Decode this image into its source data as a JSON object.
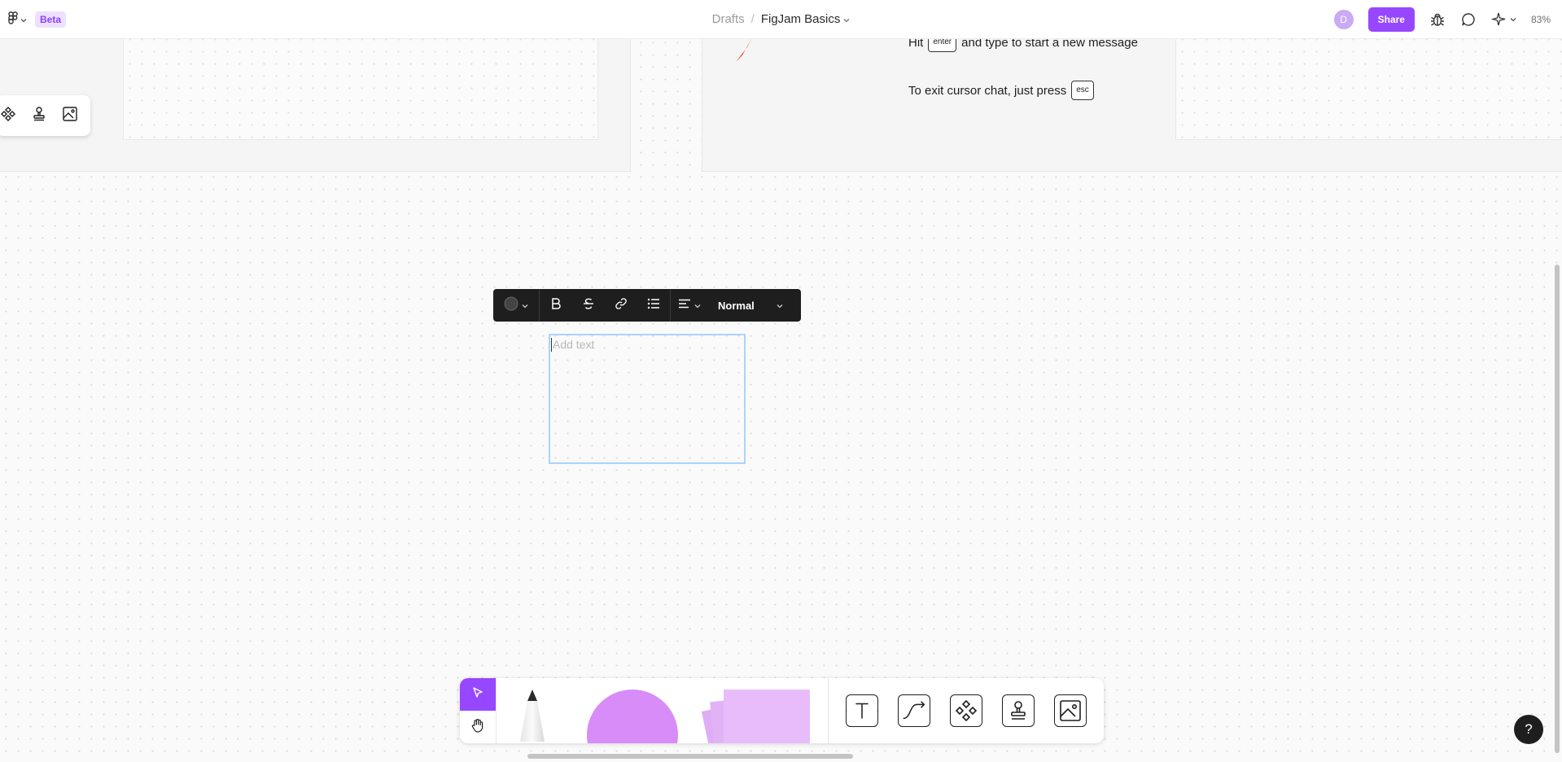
{
  "topbar": {
    "beta_label": "Beta",
    "breadcrumb_parent": "Drafts",
    "breadcrumb_sep": "/",
    "file_name": "FigJam Basics",
    "avatar_initial": "D",
    "share_label": "Share",
    "zoom_label": "83%"
  },
  "canvas": {
    "instruction_hit_prefix": "Hit",
    "enter_key": "enter",
    "instruction_hit_suffix": "and type to start a new message",
    "instruction_exit_prefix": "To exit cursor chat, just press",
    "esc_key": "esc"
  },
  "format_toolbar": {
    "text_style": "Normal"
  },
  "textbox": {
    "placeholder": "Add text"
  },
  "help": {
    "label": "?"
  },
  "colors": {
    "accent": "#9747ff",
    "beta_bg": "#ede1ff",
    "shape_purple": "#d88cf7",
    "sticky_purple": "#e8bcfb",
    "selection_blue": "#a8d4ff",
    "marker_red": "#f24822"
  },
  "icons": {
    "topbar": [
      "figjam-logo-icon",
      "bug-icon",
      "comment-icon",
      "ai-sparkle-icon"
    ],
    "mini_toolbar": [
      "component-icon",
      "stamp-icon",
      "image-icon"
    ],
    "format_toolbar": [
      "color-dot-icon",
      "bold-icon",
      "strikethrough-icon",
      "link-icon",
      "list-icon",
      "align-icon"
    ],
    "bottom_toolbar": [
      "cursor-icon",
      "hand-icon",
      "pen-icon",
      "shape-icon",
      "sticky-note-icon",
      "text-icon",
      "connector-icon",
      "component-icon",
      "stamp-icon",
      "image-icon"
    ]
  }
}
